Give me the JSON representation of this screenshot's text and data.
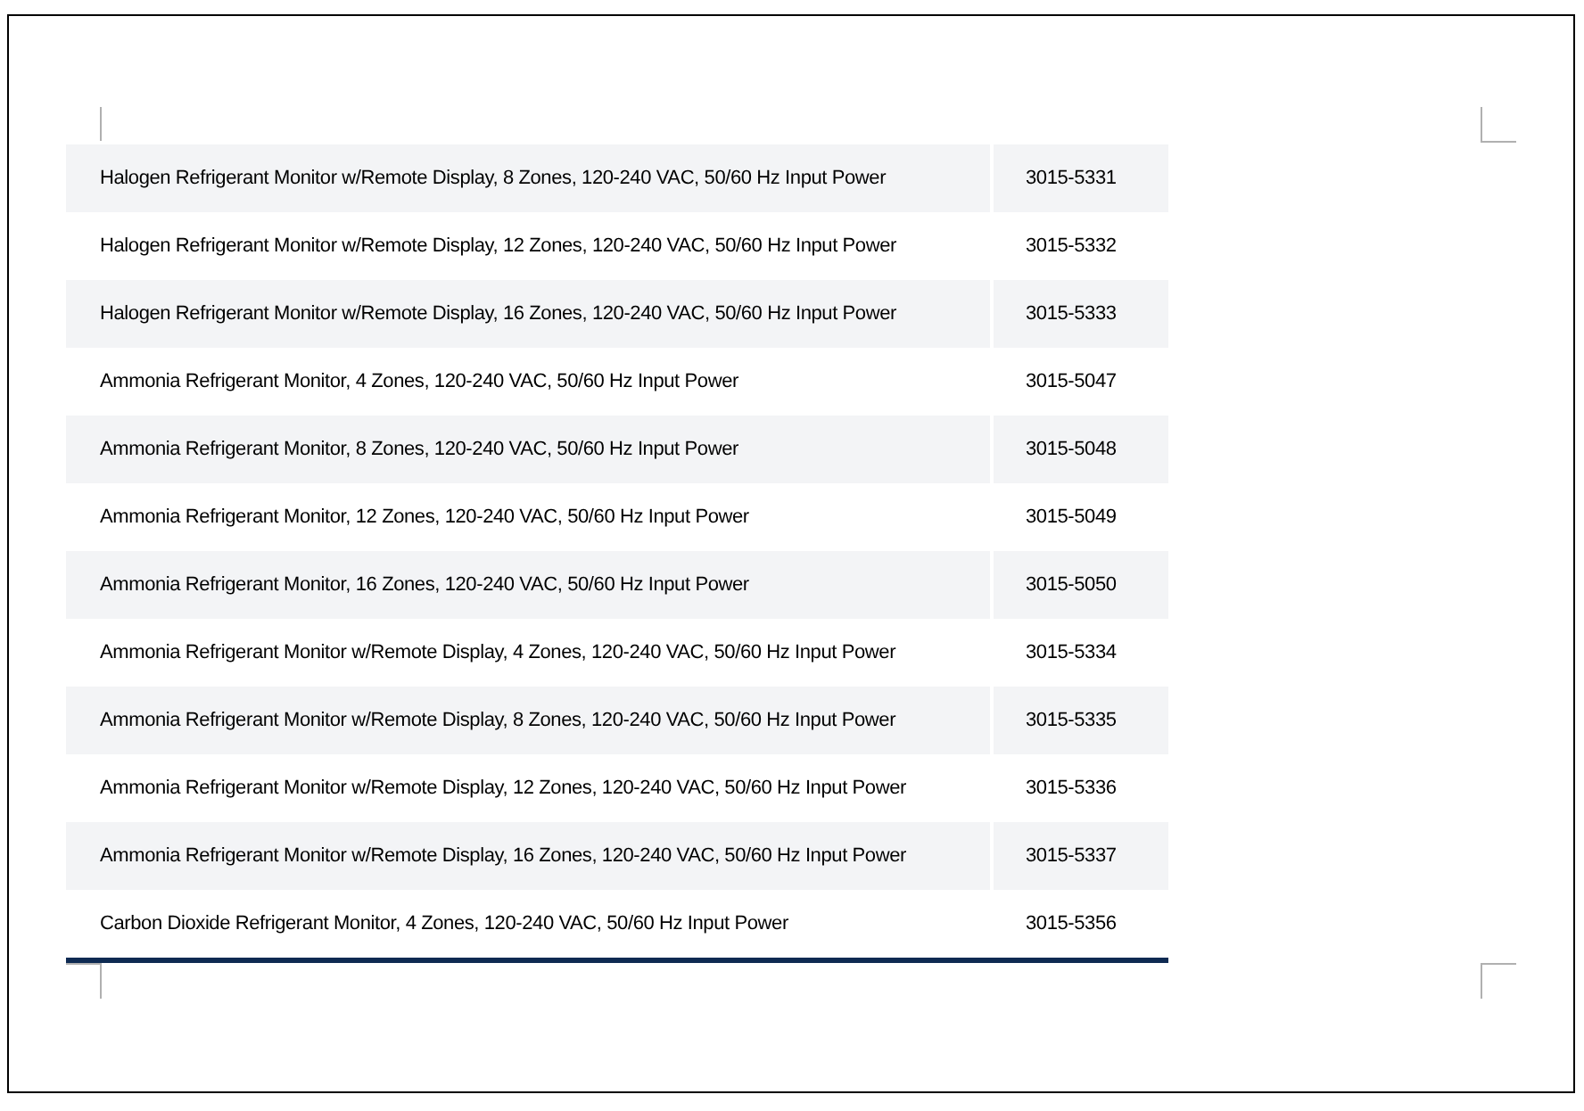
{
  "table": {
    "rows": [
      {
        "description": "Halogen Refrigerant Monitor w/Remote Display, 8 Zones, 120-240 VAC, 50/60 Hz Input Power",
        "part_number": "3015-5331"
      },
      {
        "description": "Halogen Refrigerant Monitor w/Remote Display, 12 Zones, 120-240 VAC, 50/60 Hz Input Power",
        "part_number": "3015-5332"
      },
      {
        "description": "Halogen Refrigerant Monitor w/Remote Display, 16 Zones, 120-240 VAC, 50/60 Hz Input Power",
        "part_number": "3015-5333"
      },
      {
        "description": "Ammonia Refrigerant Monitor, 4 Zones, 120-240 VAC, 50/60 Hz Input Power",
        "part_number": "3015-5047"
      },
      {
        "description": "Ammonia Refrigerant Monitor, 8 Zones, 120-240 VAC, 50/60 Hz Input Power",
        "part_number": "3015-5048"
      },
      {
        "description": "Ammonia Refrigerant Monitor, 12 Zones, 120-240 VAC, 50/60 Hz Input Power",
        "part_number": "3015-5049"
      },
      {
        "description": "Ammonia Refrigerant Monitor, 16 Zones, 120-240 VAC, 50/60 Hz Input Power",
        "part_number": "3015-5050"
      },
      {
        "description": "Ammonia Refrigerant Monitor w/Remote Display, 4 Zones, 120-240 VAC, 50/60 Hz Input Power",
        "part_number": "3015-5334"
      },
      {
        "description": "Ammonia Refrigerant Monitor w/Remote Display, 8 Zones, 120-240 VAC, 50/60 Hz Input Power",
        "part_number": "3015-5335"
      },
      {
        "description": "Ammonia Refrigerant Monitor w/Remote Display, 12 Zones, 120-240 VAC, 50/60 Hz Input Power",
        "part_number": "3015-5336"
      },
      {
        "description": "Ammonia Refrigerant Monitor w/Remote Display, 16 Zones, 120-240 VAC, 50/60 Hz Input Power",
        "part_number": "3015-5337"
      },
      {
        "description": "Carbon Dioxide Refrigerant Monitor, 4 Zones, 120-240 VAC, 50/60 Hz Input Power",
        "part_number": "3015-5356"
      }
    ]
  }
}
